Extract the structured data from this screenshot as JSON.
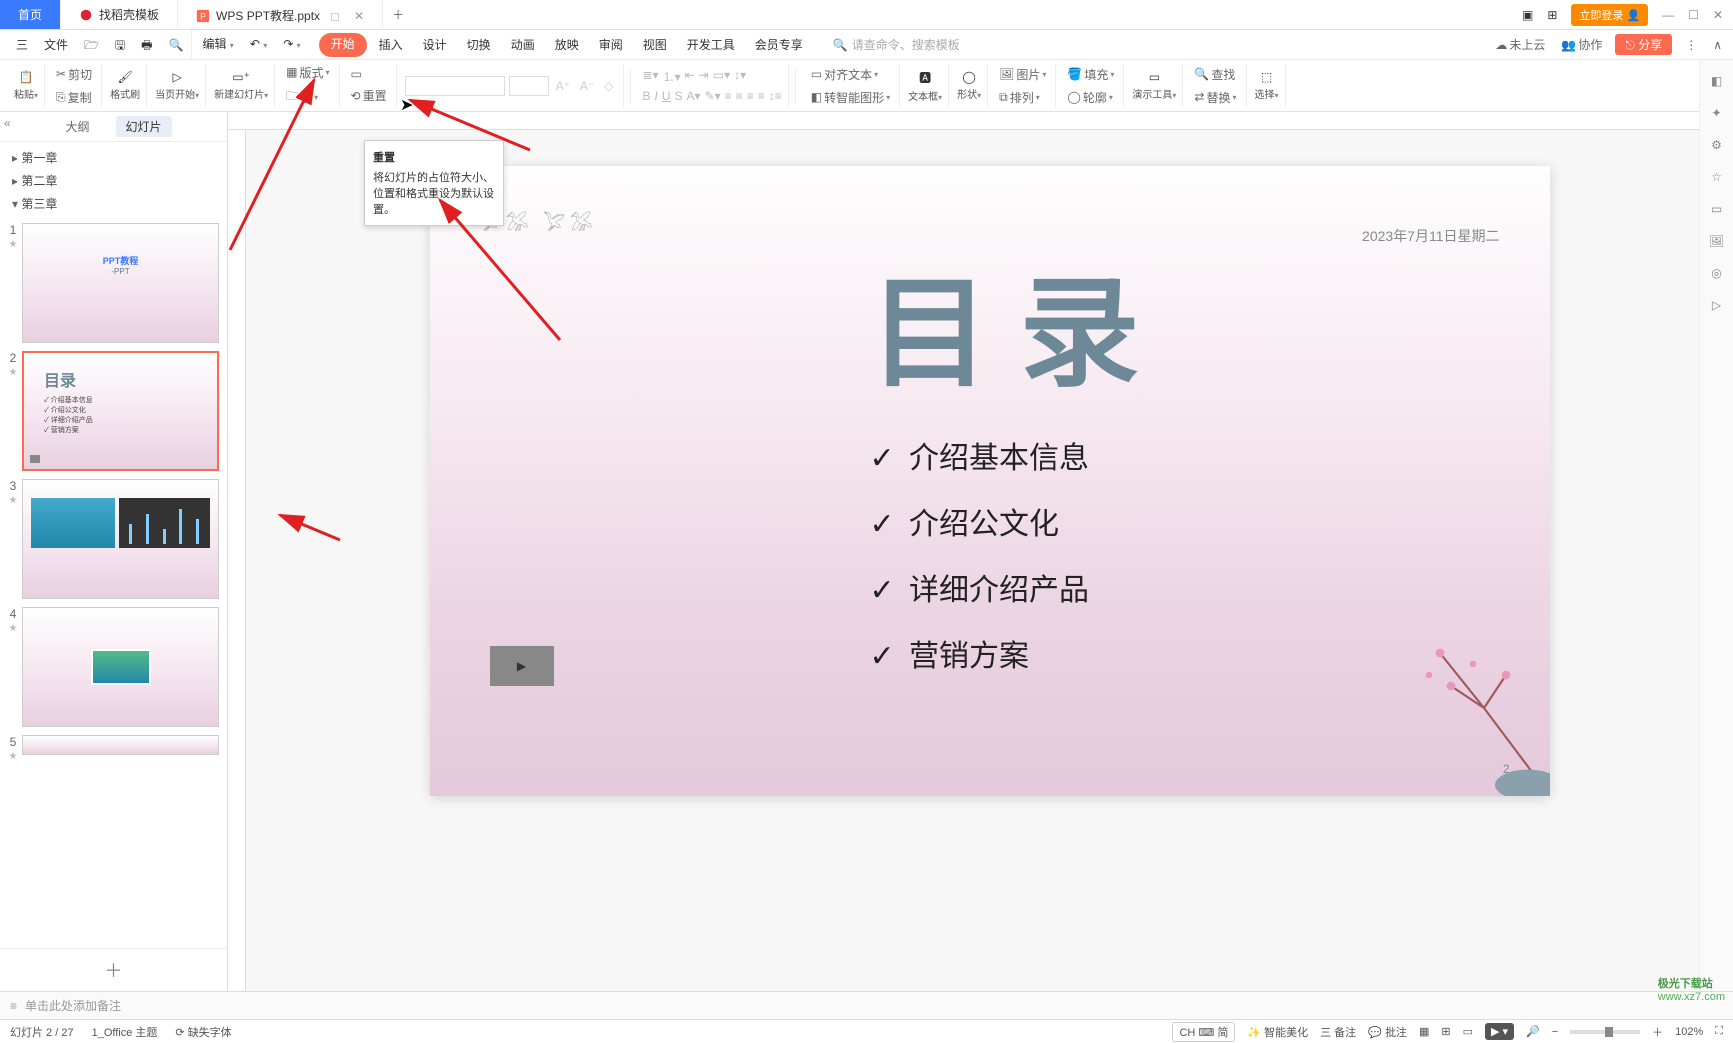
{
  "titlebar": {
    "home": "首页",
    "tab_template": "找稻壳模板",
    "tab_doc": "WPS PPT教程.pptx",
    "login": "立即登录"
  },
  "menubar": {
    "three": "三",
    "file": "文件",
    "edit": "编辑",
    "tabs": [
      "开始",
      "插入",
      "设计",
      "切换",
      "动画",
      "放映",
      "审阅",
      "视图",
      "开发工具",
      "会员专享"
    ],
    "search_hint": "请查命令、搜索模板",
    "cloud": "未上云",
    "collab": "协作",
    "share": "分享"
  },
  "ribbon": {
    "paste": "粘贴",
    "cut": "剪切",
    "copy": "复制",
    "format_painter": "格式刷",
    "play_from": "当页开始",
    "new_slide": "新建幻灯片",
    "layout": "版式",
    "section": "节",
    "reset": "重置",
    "textbox": "文本框",
    "shape": "形状",
    "picture": "图片",
    "fill": "填充",
    "arrange": "排列",
    "outline": "轮廓",
    "align_text": "对齐文本",
    "convert_smart": "转智能图形",
    "demo_tools": "演示工具",
    "find": "查找",
    "replace": "替换",
    "select": "选择"
  },
  "tooltip": {
    "title": "重置",
    "body": "将幻灯片的占位符大小、位置和格式重设为默认设置。"
  },
  "slidepanel": {
    "outline": "大纲",
    "slides": "幻灯片",
    "chapters": [
      "第一章",
      "第二章",
      "第三章"
    ],
    "thumbs": [
      {
        "n": "1",
        "title": "PPT教程",
        "sub": "-PPT"
      },
      {
        "n": "2",
        "title": "目录",
        "items": [
          "介绍基本信息",
          "介绍公文化",
          "详细介绍产品",
          "营销方案"
        ]
      },
      {
        "n": "3",
        "title": ""
      },
      {
        "n": "4",
        "title": ""
      },
      {
        "n": "5",
        "title": ""
      }
    ]
  },
  "slide": {
    "date": "2023年7月11日星期二",
    "title": "目录",
    "bullets": [
      "介绍基本信息",
      "介绍公文化",
      "详细介绍产品",
      "营销方案"
    ],
    "pagenum": "2"
  },
  "notes": {
    "hint": "单击此处添加备注"
  },
  "status": {
    "pos": "幻灯片 2 / 27",
    "theme": "1_Office 主题",
    "fonts": "缺失字体",
    "ime": "CH ⌨ 简",
    "beautify": "智能美化",
    "remark": "三 备注",
    "comment": "批注",
    "zoom": "102%"
  },
  "watermark": {
    "l1": "极光下载站",
    "l2": "www.xz7.com"
  }
}
